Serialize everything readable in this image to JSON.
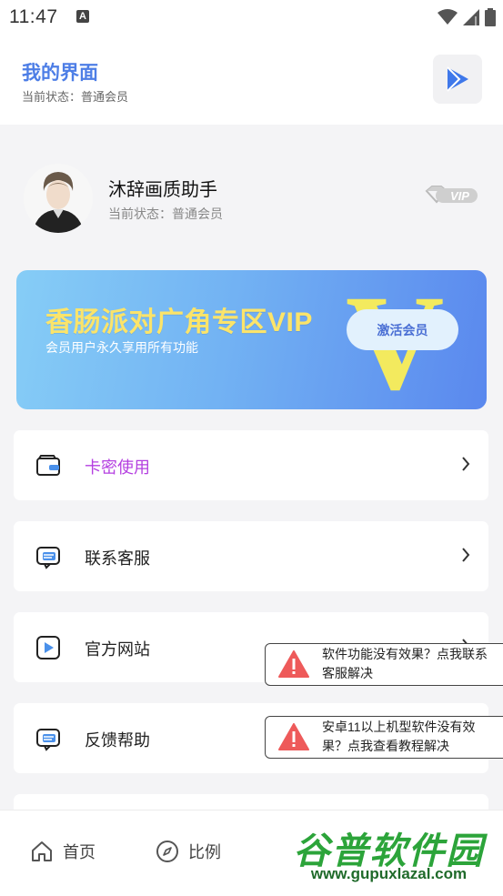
{
  "status_bar": {
    "time": "11:47",
    "a_icon": "A"
  },
  "header": {
    "title": "我的界面",
    "subtitle": "当前状态：普通会员",
    "action_icon": "play-icon"
  },
  "profile": {
    "name": "沐辞画质助手",
    "status": "当前状态：普通会员",
    "badge": "VIP"
  },
  "vip_card": {
    "title": "香肠派对广角专区VIP",
    "subtitle": "会员用户永久享用所有功能",
    "button": "激活会员",
    "watermark_letter": "V",
    "accent": "#fbe46a"
  },
  "menu": [
    {
      "label": "卡密使用",
      "icon": "wallet-icon",
      "color": "#b43fe0"
    },
    {
      "label": "联系客服",
      "icon": "chat-icon",
      "color": "#222222"
    },
    {
      "label": "官方网站",
      "icon": "play-square-icon",
      "color": "#222222"
    },
    {
      "label": "反馈帮助",
      "icon": "chat-icon",
      "color": "#222222"
    }
  ],
  "toasts": [
    {
      "text": "软件功能没有效果？点我联系客服解决",
      "icon": "warning-icon"
    },
    {
      "text": "安卓11以上机型软件没有效果？点我查看教程解决",
      "icon": "warning-icon"
    }
  ],
  "tabs": [
    {
      "label": "首页",
      "icon": "home-icon"
    },
    {
      "label": "比例",
      "icon": "compass-icon"
    }
  ],
  "watermark": {
    "name": "谷普软件园",
    "url": "www.gupuxlazal.com"
  }
}
